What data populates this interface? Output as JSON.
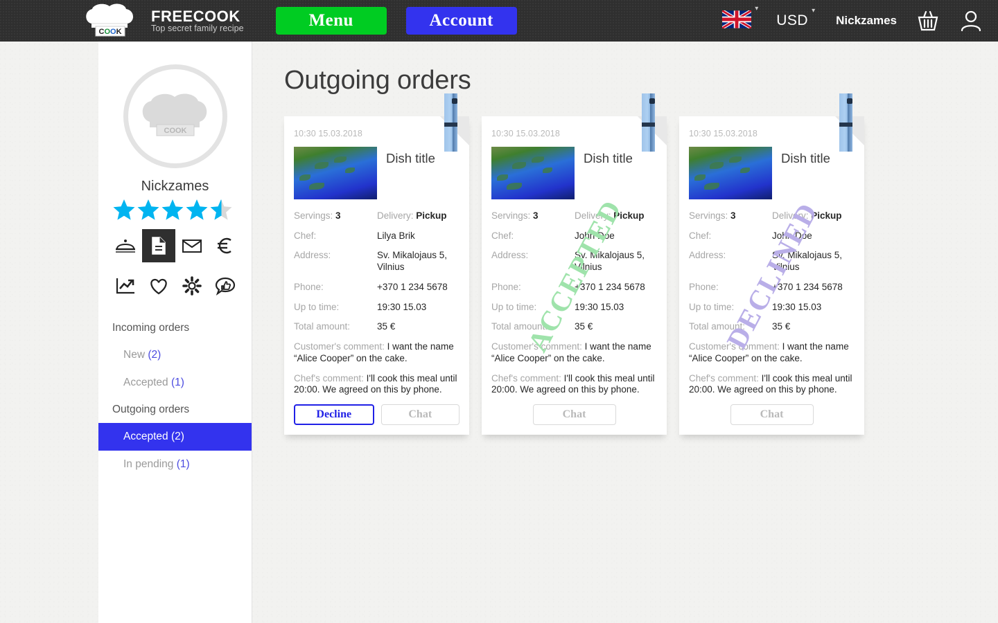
{
  "header": {
    "logo": {
      "icon": "chef-hat-logo",
      "badge": "COOK",
      "title": "FREECOOK",
      "subtitle": "Top secret family recipe"
    },
    "menu_button": "Menu",
    "account_button": "Account",
    "language": {
      "icon": "uk-flag-icon",
      "caret": "▾"
    },
    "currency": {
      "value": "USD",
      "caret": "▾"
    },
    "username": "Nickzames",
    "cart_icon": "basket-icon",
    "profile_icon": "user-icon"
  },
  "sidebar": {
    "avatar_icon": "chef-hat-avatar",
    "avatar_badge": "COOK",
    "name": "Nickzames",
    "rating": 4.5,
    "rating_max": 5,
    "icons_row1": [
      "dish-cover-icon",
      "document-icon",
      "envelope-icon",
      "euro-icon"
    ],
    "icons_row2": [
      "chart-icon",
      "heart-icon",
      "gear-icon",
      "feedback-icon"
    ],
    "active_icon": "document-icon",
    "nav": [
      {
        "type": "group",
        "label": "Incoming orders"
      },
      {
        "type": "item",
        "label": "New",
        "count": "(2)",
        "selected": false
      },
      {
        "type": "item",
        "label": "Accepted",
        "count": "(1)",
        "selected": false
      },
      {
        "type": "group",
        "label": "Outgoing orders"
      },
      {
        "type": "item",
        "label": "Accepted",
        "count": "(2)",
        "selected": true
      },
      {
        "type": "item",
        "label": "In pending",
        "count": "(1)",
        "selected": false
      }
    ]
  },
  "main": {
    "page_title": "Outgoing orders",
    "labels": {
      "servings": "Servings:",
      "delivery": "Delivery:",
      "chef": "Chef:",
      "address": "Address:",
      "phone": "Phone:",
      "up_to_time": "Up to time:",
      "total_amount": "Total amount:",
      "customer_comment": "Customer's comment:",
      "chef_comment": "Chef's comment:"
    },
    "cards": [
      {
        "date": "10:30 15.03.2018",
        "dish_title": "Dish title",
        "servings": "3",
        "delivery": "Pickup",
        "chef": "Lilya Brik",
        "address": "Sv. Mikalojaus 5, Vilnius",
        "phone": "+370 1 234 5678",
        "up_to_time": "19:30 15.03",
        "total_amount": "35 €",
        "customer_comment": "I want the name “Alice Cooper” on the cake.",
        "chef_comment": "I'll cook this meal until 20:00. We agreed on this by phone.",
        "stamp": "",
        "buttons": [
          "Decline",
          "Chat"
        ]
      },
      {
        "date": "10:30 15.03.2018",
        "dish_title": "Dish title",
        "servings": "3",
        "delivery": "Pickup",
        "chef": "John Doe",
        "address": "Sv. Mikalojaus 5, Vilnius",
        "phone": "+370 1 234 5678",
        "up_to_time": "19:30 15.03",
        "total_amount": "35 €",
        "customer_comment": "I want the name “Alice Cooper” on the cake.",
        "chef_comment": "I'll cook this meal until 20:00. We agreed on this by phone.",
        "stamp": "ACCEPTED",
        "stamp_color": "#9fe3ab",
        "buttons": [
          "Chat"
        ]
      },
      {
        "date": "10:30 15.03.2018",
        "dish_title": "Dish title",
        "servings": "3",
        "delivery": "Pickup",
        "chef": "John Doe",
        "address": "Sv. Mikalojaus 5, Vilnius",
        "phone": "+370 1 234 5678",
        "up_to_time": "19:30 15.03",
        "total_amount": "35 €",
        "customer_comment": "I want the name “Alice Cooper” on the cake.",
        "chef_comment": "I'll cook this meal until 20:00. We agreed on this by phone.",
        "stamp": "DECLINED",
        "stamp_color": "#b9aee8",
        "buttons": [
          "Chat"
        ]
      }
    ]
  },
  "colors": {
    "header_bg": "#2f2f2f",
    "menu_green": "#00cc22",
    "account_blue": "#3333ee",
    "star_cyan": "#00b4f0",
    "selected_nav": "#3333ee",
    "count_blue": "#4b4be0"
  }
}
